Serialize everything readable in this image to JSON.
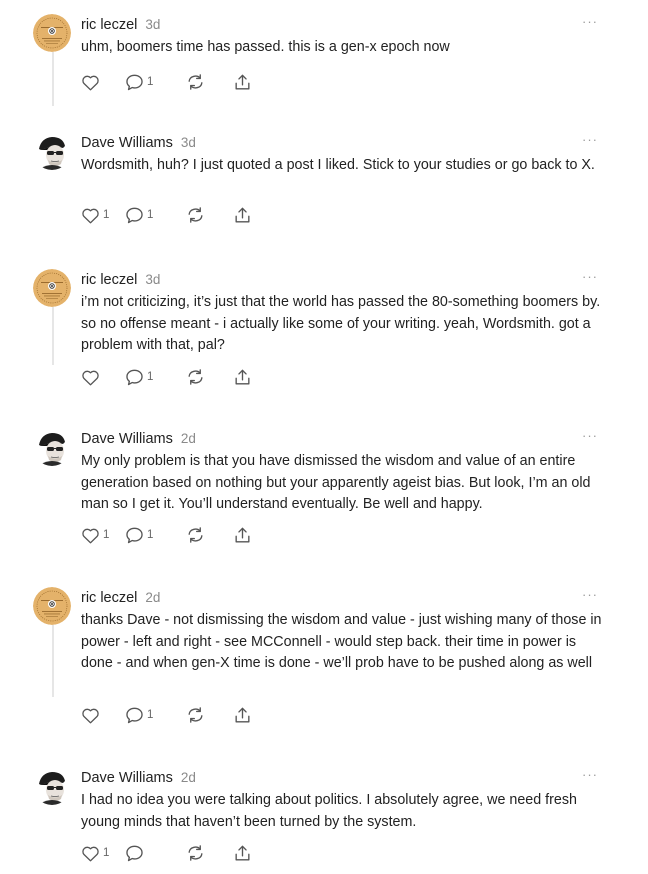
{
  "comments": [
    {
      "author": "ric leczel",
      "time": "3d",
      "avatar": "seal-logo",
      "text": "uhm, boomers time has passed. this is a gen-x epoch now",
      "likes": "",
      "replies": "1"
    },
    {
      "author": "Dave Williams",
      "time": "3d",
      "avatar": "man-in-cap",
      "text": "Wordsmith, huh? I just quoted a post I liked. Stick to your studies or go back to X.",
      "likes": "1",
      "replies": "1"
    },
    {
      "author": "ric leczel",
      "time": "3d",
      "avatar": "seal-logo",
      "text": "i’m not criticizing, it’s just that the world has passed the 80-something boomers by. so no offense meant - i actually like some of your writing. yeah, Wordsmith. got a problem with that, pal?",
      "likes": "",
      "replies": "1"
    },
    {
      "author": "Dave Williams",
      "time": "2d",
      "avatar": "man-in-cap",
      "text": "My only problem is that you have dismissed the wisdom and value of an entire generation based on nothing but your apparently ageist bias. But look, I’m an old man so I get it. You’ll understand eventually. Be well and happy.",
      "likes": "1",
      "replies": "1"
    },
    {
      "author": "ric leczel",
      "time": "2d",
      "avatar": "seal-logo",
      "text": "thanks Dave - not dismissing the wisdom and value - just wishing many of those in power - left and right - see MCConnell - would step back. their time in power is done - and when gen-X time is done - we’ll prob have to be pushed along as well",
      "likes": "",
      "replies": "1"
    },
    {
      "author": "Dave Williams",
      "time": "2d",
      "avatar": "man-in-cap",
      "text": "I had no idea you were talking about politics. I absolutely agree, we need fresh young minds that haven’t been turned by the system.",
      "likes": "1",
      "replies": ""
    }
  ],
  "icons": {
    "like": "heart-icon",
    "reply": "comment-bubble-icon",
    "restack": "restack-arrows-icon",
    "share": "share-upload-icon",
    "more": "more-dots-icon"
  },
  "more_glyph": "···",
  "colors": {
    "text": "#222222",
    "muted": "#8a8a8a",
    "icon": "#555555",
    "thread_line": "#e6e6e6",
    "seal_bg": "#e4b26a"
  }
}
